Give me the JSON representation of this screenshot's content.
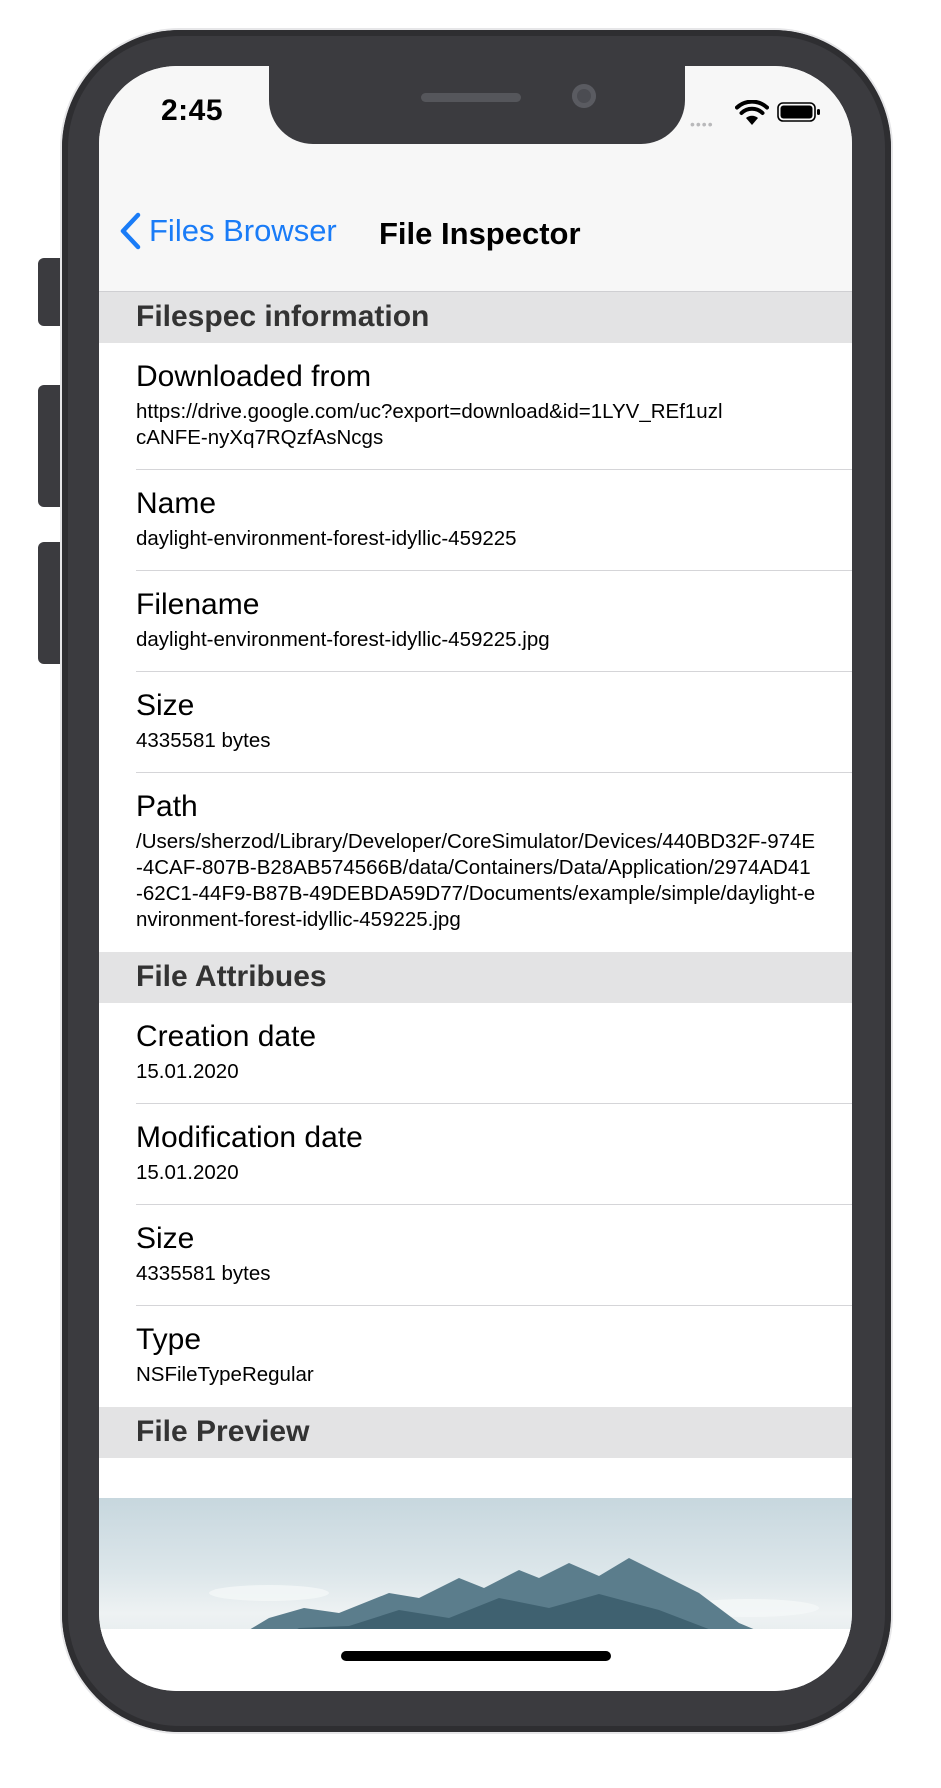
{
  "status_bar": {
    "time": "2:45",
    "signal": "••••",
    "icons": [
      "wifi-icon",
      "battery-icon"
    ]
  },
  "nav": {
    "back_label": "Files Browser",
    "title": "File Inspector",
    "accent_color": "#1a7cf7"
  },
  "sections": {
    "filespec": {
      "header": "Filespec information",
      "rows": [
        {
          "title": "Downloaded from",
          "value": "https://drive.google.com/uc?export=download&id=1LYV_REf1uzlcANFE-nyXq7RQzfAsNcgs"
        },
        {
          "title": "Name",
          "value": "daylight-environment-forest-idyllic-459225"
        },
        {
          "title": "Filename",
          "value": "daylight-environment-forest-idyllic-459225.jpg"
        },
        {
          "title": "Size",
          "value": "4335581 bytes"
        },
        {
          "title": "Path",
          "value": "/Users/sherzod/Library/Developer/CoreSimulator/Devices/440BD32F-974E-4CAF-807B-B28AB574566B/data/Containers/Data/Application/2974AD41-62C1-44F9-B87B-49DEBDA59D77/Documents/example/simple/daylight-environment-forest-idyllic-459225.jpg"
        }
      ]
    },
    "attributes": {
      "header": "File Attribues",
      "rows": [
        {
          "title": "Creation date",
          "value": "15.01.2020"
        },
        {
          "title": "Modification date",
          "value": "15.01.2020"
        },
        {
          "title": "Size",
          "value": "4335581 bytes"
        },
        {
          "title": "Type",
          "value": "NSFileTypeRegular"
        }
      ]
    },
    "preview": {
      "header": "File Preview"
    }
  }
}
